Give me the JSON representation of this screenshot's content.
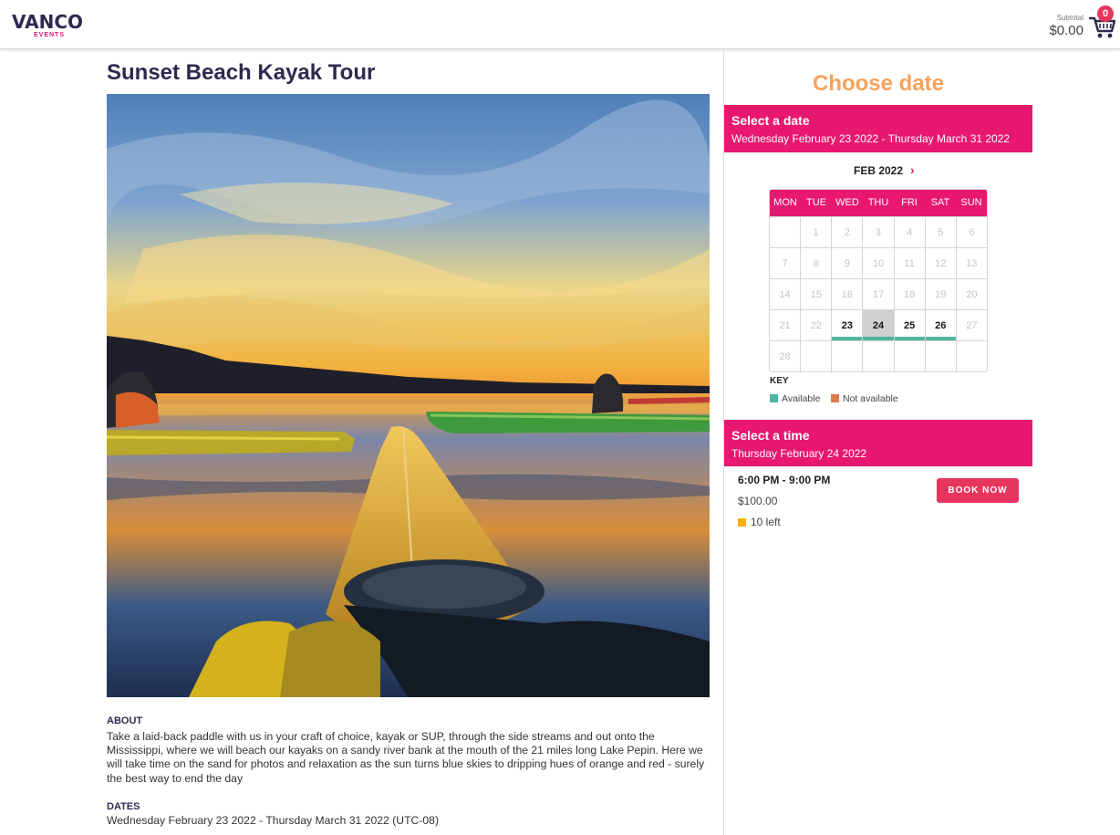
{
  "header": {
    "logo_main": "VANCO",
    "logo_sub": "EVENTS",
    "subtotal_label": "Subtotal",
    "subtotal_value": "$0.00",
    "cart_count": "0"
  },
  "event": {
    "title": "Sunset Beach Kayak Tour",
    "about_label": "ABOUT",
    "about_text": "Take a laid-back paddle with us in your craft of choice, kayak or SUP, through the side streams and out onto the Mississippi, where we will beach our kayaks on a sandy river bank at the mouth of the 21 miles long Lake Pepin. Here we will take time on the sand for photos and relaxation as the sun turns blue skies to dripping hues of orange and red - surely the best way to end the day",
    "dates_label": "DATES",
    "dates_text": "Wednesday February 23 2022 - Thursday March 31 2022 (UTC-08)"
  },
  "booking": {
    "choose_title": "Choose date",
    "select_date_title": "Select a date",
    "select_date_range": "Wednesday February 23 2022 - Thursday March 31 2022",
    "month_label": "FEB 2022",
    "next_icon": "chevron-right-icon",
    "weekdays": [
      "MON",
      "TUE",
      "WED",
      "THU",
      "FRI",
      "SAT",
      "SUN"
    ],
    "weeks": [
      [
        "",
        "1",
        "2",
        "3",
        "4",
        "5",
        "6"
      ],
      [
        "7",
        "8",
        "9",
        "10",
        "11",
        "12",
        "13"
      ],
      [
        "14",
        "15",
        "16",
        "17",
        "18",
        "19",
        "20"
      ],
      [
        "21",
        "22",
        "23",
        "24",
        "25",
        "26",
        "27"
      ],
      [
        "28",
        "",
        "",
        "",
        "",
        "",
        ""
      ]
    ],
    "available_days": [
      "23",
      "24",
      "25",
      "26"
    ],
    "selected_day": "24",
    "key_label": "KEY",
    "key_available": "Available",
    "key_not_available": "Not available",
    "select_time_title": "Select a time",
    "select_time_date": "Thursday February 24 2022",
    "slot": {
      "time": "6:00 PM - 9:00 PM",
      "price": "$100.00",
      "remaining": "10 left",
      "book_label": "BOOK NOW"
    }
  },
  "colors": {
    "brand_pink": "#e8176f",
    "accent_orange": "#f7a25c",
    "available_teal": "#4db6a0",
    "not_available_orange": "#e07a4c",
    "remaining_yellow": "#f5b400",
    "title_navy": "#2e2a4f"
  }
}
